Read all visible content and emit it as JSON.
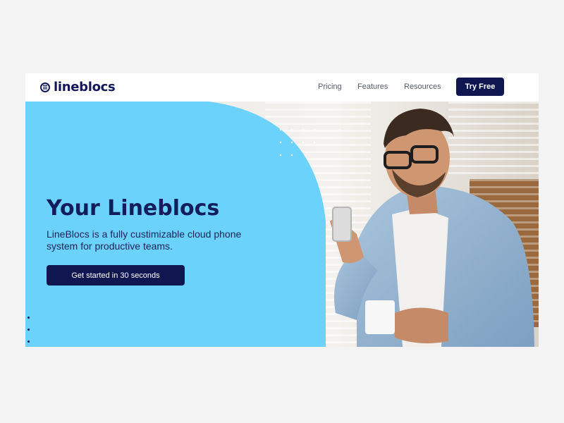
{
  "header": {
    "logo_text": "lineblocs",
    "nav": [
      {
        "label": "Pricing"
      },
      {
        "label": "Features"
      },
      {
        "label": "Resources"
      }
    ],
    "cta_label": "Try Free"
  },
  "hero": {
    "title": "Your Lineblocs",
    "subtitle": "LineBlocs is a fully custimizable cloud phone system for productive teams.",
    "cta_label": "Get started in 30 seconds"
  },
  "colors": {
    "brand_navy": "#0f1650",
    "hero_blue": "#6ad2fb",
    "page_bg": "#f3f3f3"
  },
  "icons": [
    "lineblocs-logo-icon"
  ]
}
